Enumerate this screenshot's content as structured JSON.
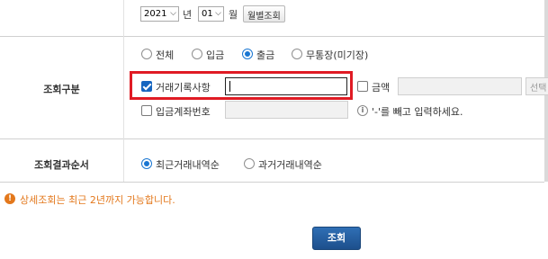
{
  "date_row": {
    "year_value": "2021",
    "year_unit": "년",
    "month_value": "01",
    "month_unit": "월",
    "monthly_button": "월별조회"
  },
  "query_type": {
    "label": "조회구분",
    "options": [
      "전체",
      "입금",
      "출금",
      "무통장(미기장)"
    ],
    "selected": "출금",
    "transaction_record": {
      "label": "거래기록사항",
      "checked": true,
      "value": ""
    },
    "amount": {
      "label": "금액",
      "checked": false,
      "select_label": "선택"
    },
    "deposit_account": {
      "label": "입금계좌번호",
      "checked": false
    },
    "hint": "'-'를 빼고 입력하세요."
  },
  "sort_order": {
    "label": "조회결과순서",
    "options": [
      "최근거래내역순",
      "과거거래내역순"
    ],
    "selected": "최근거래내역순"
  },
  "notice": "상세조회는 최근 2년까지 가능합니다.",
  "search_button": "조회",
  "colors": {
    "highlight": "#e01b24",
    "primary": "#1d4f8c",
    "warning": "#e3781c",
    "radio": "#1976d2"
  },
  "icons": [
    "chevron-down-icon",
    "info-icon",
    "warning-icon"
  ]
}
